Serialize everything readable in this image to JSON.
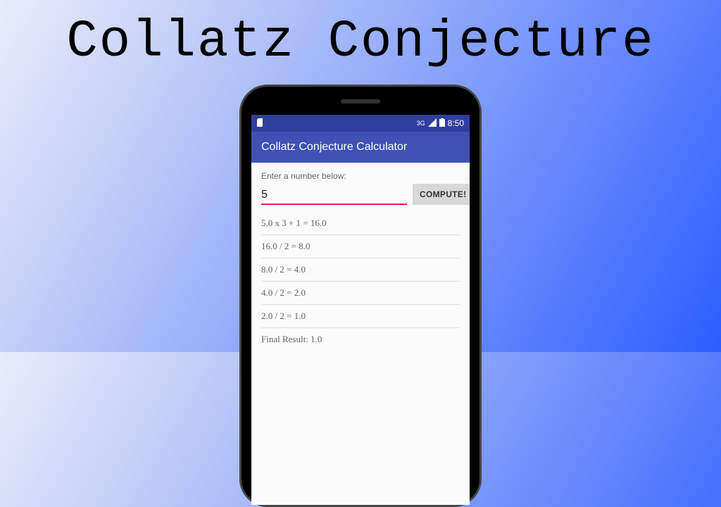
{
  "hero": {
    "title": "Collatz Conjecture"
  },
  "statusbar": {
    "network": "3G",
    "time": "8:50"
  },
  "appbar": {
    "title": "Collatz Conjecture Calculator"
  },
  "form": {
    "prompt": "Enter a number below:",
    "input_value": "5",
    "compute_label": "COMPUTE!"
  },
  "results": {
    "r0": "5.0 x 3 + 1 = 16.0",
    "r1": "16.0 / 2 = 8.0",
    "r2": "8.0 / 2 = 4.0",
    "r3": "4.0 / 2 = 2.0",
    "r4": "2.0 / 2 = 1.0",
    "final": "Final Result: 1.0"
  }
}
